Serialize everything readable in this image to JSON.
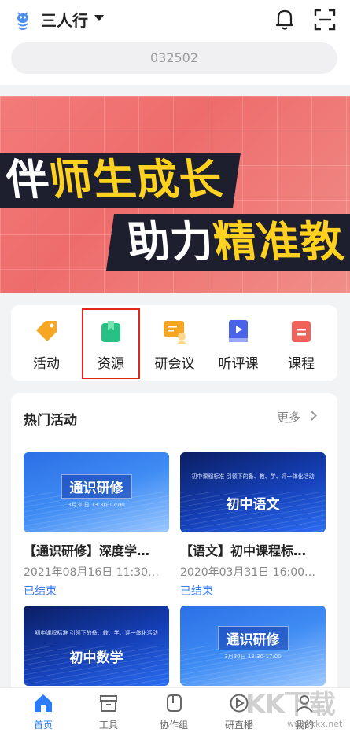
{
  "header": {
    "title": "三人行",
    "search_value": "032502"
  },
  "banner": {
    "line1_a": "伴",
    "line1_b": "师生成长",
    "line2_a": "助力",
    "line2_b": "精准教"
  },
  "functions": [
    {
      "label": "活动",
      "icon": "tag-icon"
    },
    {
      "label": "资源",
      "icon": "folder-icon"
    },
    {
      "label": "研会议",
      "icon": "meeting-icon"
    },
    {
      "label": "听评课",
      "icon": "play-book-icon"
    },
    {
      "label": "课程",
      "icon": "course-icon"
    }
  ],
  "hot": {
    "title": "热门活动",
    "more": "更多"
  },
  "cards": [
    {
      "thumb_text": "通识研修",
      "thumb_sub": "3月30日 13:30-17:00",
      "title": "【通识研修】深度学…",
      "date": "2021年08月16日 11:30…",
      "status": "已结束"
    },
    {
      "thumb_text": "初中语文",
      "thumb_sub": "初中课程标准 引领下的备、教、学、评一体化活动",
      "title": "【语文】初中课程标…",
      "date": "2020年03月31日 16:00…",
      "status": "已结束"
    },
    {
      "thumb_text": "初中数学",
      "thumb_sub": "初中课程标准 引领下的备、教、学、评一体化活动"
    },
    {
      "thumb_text": "通识研修",
      "thumb_sub": "3月30日 13:30-17:00"
    }
  ],
  "tabs": [
    {
      "label": "首页",
      "icon": "home-icon",
      "active": true
    },
    {
      "label": "工具",
      "icon": "toolbox-icon"
    },
    {
      "label": "协作组",
      "icon": "group-icon"
    },
    {
      "label": "研直播",
      "icon": "live-play-icon"
    },
    {
      "label": "我的",
      "icon": "user-icon"
    }
  ],
  "watermark": {
    "text": "KK下载",
    "url": "www.kkx.net"
  },
  "colors": {
    "accent": "#2b7cf6",
    "status": "#3b7df0",
    "highlight": "#e1251b",
    "banner": "#ee6c6c",
    "slogan_yellow": "#ffd21f"
  }
}
